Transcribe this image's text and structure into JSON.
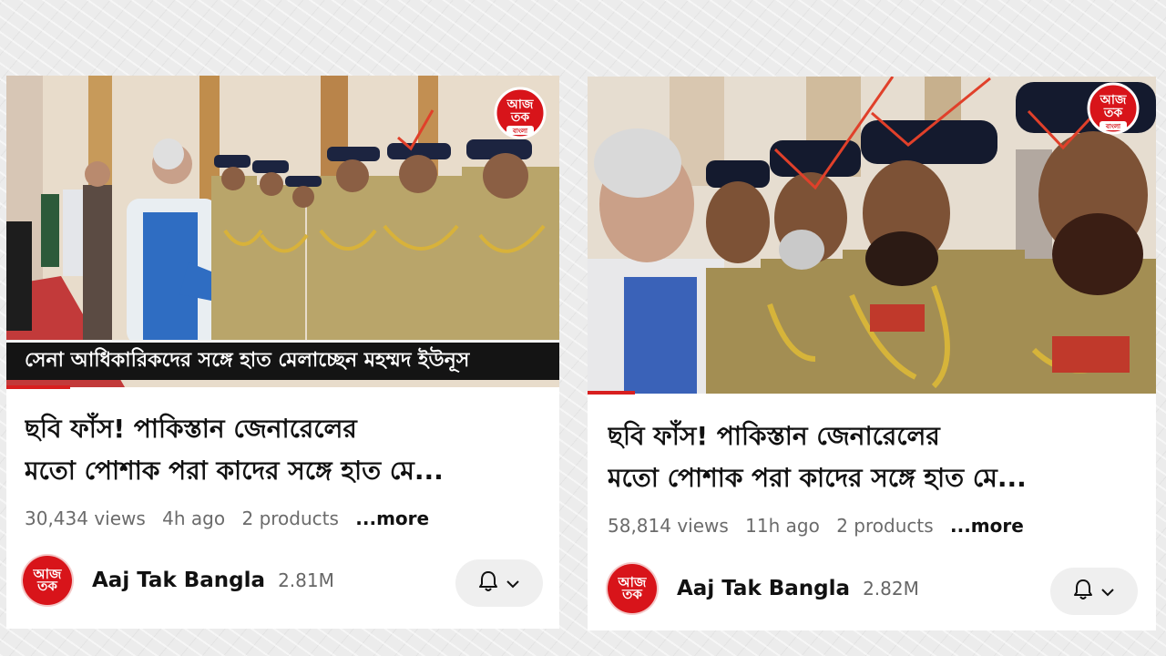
{
  "videos": [
    {
      "caption": "সেনা আধিকারিকদের সঙ্গে হাত মেলাচ্ছেন মহম্মদ ইউনূস",
      "title_line1": "ছবি ফাঁস! পাকিস্তান জেনারেলের",
      "title_line2": "মতো পোশাক পরা কাদের সঙ্গে হাত মে...",
      "views": "30,434 views",
      "age": "4h ago",
      "products": "2 products",
      "more": "...more",
      "channel": "Aaj Tak Bangla",
      "subscribers": "2.81M"
    },
    {
      "title_line1": "ছবি ফাঁস! পাকিস্তান জেনারেলের",
      "title_line2": "মতো পোশাক পরা কাদের সঙ্গে হাত মে...",
      "views": "58,814 views",
      "age": "11h ago",
      "products": "2 products",
      "more": "...more",
      "channel": "Aaj Tak Bangla",
      "subscribers": "2.82M"
    }
  ],
  "logo": {
    "line1": "আজ",
    "line2": "তক",
    "line3": "বাংলা"
  },
  "icons": {
    "bell": "bell-icon",
    "chevron": "chevron-down-icon"
  },
  "colors": {
    "brand_red": "#d8141a",
    "progress_red": "#d81f1f"
  }
}
